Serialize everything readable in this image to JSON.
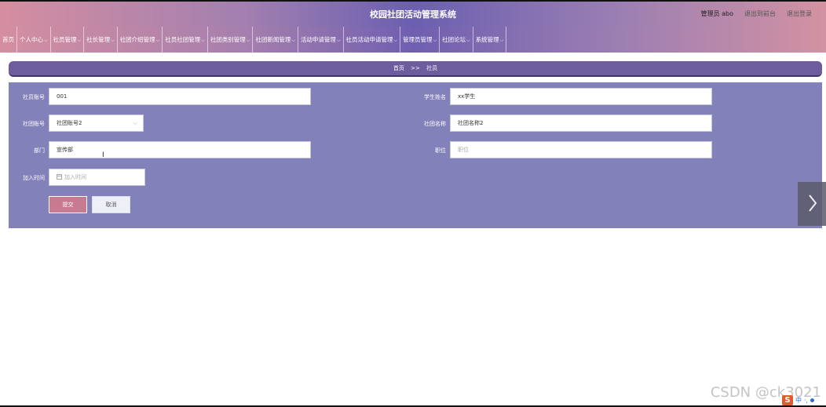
{
  "header": {
    "title": "校园社团活动管理系统",
    "admin_label": "管理员 abo",
    "back_to_front": "退出到前台",
    "logout": "退出登录"
  },
  "nav": {
    "items": [
      {
        "label": "首页",
        "has_dropdown": false
      },
      {
        "label": "个人中心",
        "has_dropdown": true
      },
      {
        "label": "社员管理",
        "has_dropdown": true
      },
      {
        "label": "社长管理",
        "has_dropdown": true
      },
      {
        "label": "社团介绍管理",
        "has_dropdown": true
      },
      {
        "label": "社员社团管理",
        "has_dropdown": true
      },
      {
        "label": "社团类别管理",
        "has_dropdown": true
      },
      {
        "label": "社团新闻管理",
        "has_dropdown": true
      },
      {
        "label": "活动申请管理",
        "has_dropdown": true
      },
      {
        "label": "社员活动申请管理",
        "has_dropdown": true
      },
      {
        "label": "管理员管理",
        "has_dropdown": true
      },
      {
        "label": "社团论坛",
        "has_dropdown": true
      },
      {
        "label": "系统管理",
        "has_dropdown": true
      }
    ]
  },
  "breadcrumb": {
    "home": "首页",
    "separator": ">>",
    "current": "社员"
  },
  "form": {
    "member_account_label": "社员账号",
    "member_account_value": "001",
    "student_name_label": "学生姓名",
    "student_name_value": "xx学生",
    "club_account_label": "社团账号",
    "club_account_value": "社团账号2",
    "club_name_label": "社团名称",
    "club_name_value": "社团名称2",
    "department_label": "部门",
    "department_value": "宣传部",
    "position_label": "职位",
    "position_placeholder": "职位",
    "join_time_label": "加入时间",
    "join_time_placeholder": "加入时间",
    "submit_label": "提交",
    "cancel_label": "取消"
  },
  "watermark": "CSDN @ck3021",
  "tray": {
    "ime_text": "中",
    "extra": "·,"
  },
  "colors": {
    "header_gradient_mid": "#6a5fb0",
    "header_gradient_edge": "#d58ea0",
    "panel": "#8381b9",
    "breadcrumb": "#6e5d9e",
    "submit": "#c87a90"
  }
}
